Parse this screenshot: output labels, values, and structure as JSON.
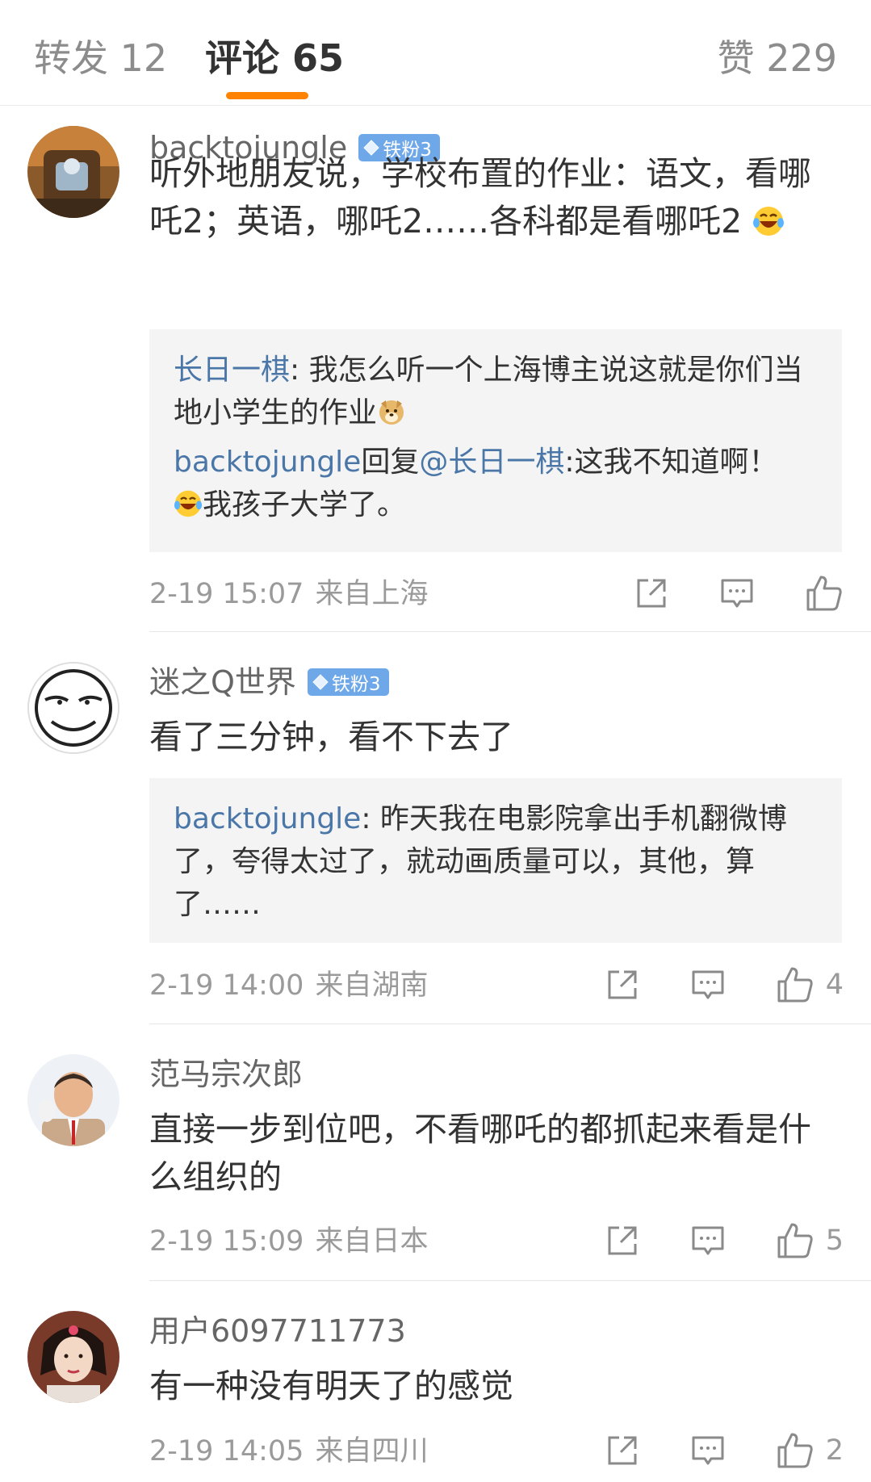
{
  "tabs": {
    "repost": "转发 12",
    "comments": "评论 65",
    "likes": "赞 229"
  },
  "comments": [
    {
      "username": "backtojungle",
      "badge": "铁粉3",
      "text": "听外地朋友说，学校布置的作业：语文，看哪吒2；英语，哪吒2……各科都是看哪吒2",
      "emoji": "laugh-cry-emoji",
      "replies": [
        {
          "author": "长日一棋",
          "sep": ": ",
          "text": "我怎么听一个上海博主说这就是你们当地小学生的作业",
          "emoji": "doge-emoji"
        },
        {
          "author": "backtojungle",
          "reply_word": "回复",
          "mention": "@长日一棋",
          "sep": ":",
          "text": "这我不知道啊！",
          "text2": "我孩子大学了。",
          "emoji": "laugh-cry-emoji"
        }
      ],
      "time": "2-19 15:07",
      "location": "来自上海",
      "like_count": ""
    },
    {
      "username": "迷之Q世界",
      "badge": "铁粉3",
      "text": "看了三分钟，看不下去了",
      "replies": [
        {
          "author": "backtojungle",
          "sep": ": ",
          "text": "昨天我在电影院拿出手机翻微博了，夸得太过了，就动画质量可以，其他，算了……"
        }
      ],
      "time": "2-19 14:00",
      "location": "来自湖南",
      "like_count": "4"
    },
    {
      "username": "范马宗次郎",
      "text": "直接一步到位吧，不看哪吒的都抓起来看是什么组织的",
      "time": "2-19 15:09",
      "location": "来自日本",
      "like_count": "5"
    },
    {
      "username": "用户6097711773",
      "text": "有一种没有明天了的感觉",
      "time": "2-19 14:05",
      "location": "来自四川",
      "like_count": "2"
    }
  ],
  "colors": {
    "accent": "#ff8200",
    "link": "#4a77a8",
    "badge": "#6fa8e8",
    "meta": "#9a9a9a"
  }
}
